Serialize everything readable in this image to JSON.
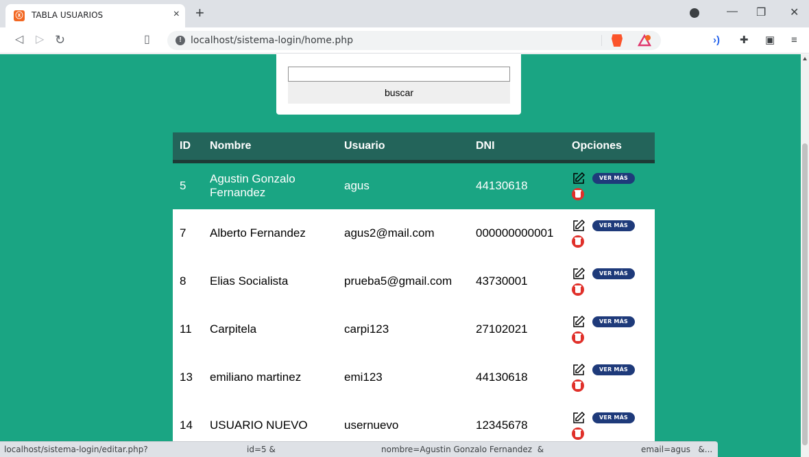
{
  "browser": {
    "tab_title": "TABLA USUARIOS",
    "tab_close": "×",
    "new_tab": "+",
    "url": "localhost/sistema-login/home.php"
  },
  "search": {
    "value": "",
    "button_label": "buscar"
  },
  "table": {
    "headers": [
      "ID",
      "Nombre",
      "Usuario",
      "DNI",
      "Opciones"
    ],
    "rows": [
      {
        "id": "5",
        "nombre": "Agustin Gonzalo Fernandez",
        "usuario": "agus",
        "dni": "44130618",
        "ver_label": "VER MÁS"
      },
      {
        "id": "7",
        "nombre": "Alberto Fernandez",
        "usuario": "agus2@mail.com",
        "dni": "000000000001",
        "ver_label": "VER MÁS"
      },
      {
        "id": "8",
        "nombre": "Elias Socialista",
        "usuario": "prueba5@gmail.com",
        "dni": "43730001",
        "ver_label": "VER MÁS"
      },
      {
        "id": "11",
        "nombre": "Carpitela",
        "usuario": "carpi123",
        "dni": "27102021",
        "ver_label": "VER MÁS"
      },
      {
        "id": "13",
        "nombre": "emiliano martinez",
        "usuario": "emi123",
        "dni": "44130618",
        "ver_label": "VER MÁS"
      },
      {
        "id": "14",
        "nombre": "USUARIO NUEVO",
        "usuario": "usernuevo",
        "dni": "12345678",
        "ver_label": "VER MÁS"
      }
    ]
  },
  "statusbar": {
    "part1": "localhost/sistema-login/editar.php?",
    "part2": "id=5 &",
    "part3": "nombre=Agustin Gonzalo Fernandez  &",
    "part4": "email=agus   &..."
  },
  "colors": {
    "page_bg": "#1aa583",
    "header_bg": "#23645a",
    "ver_mas_bg": "#1e3a7a",
    "delete_red": "#e0302a"
  }
}
